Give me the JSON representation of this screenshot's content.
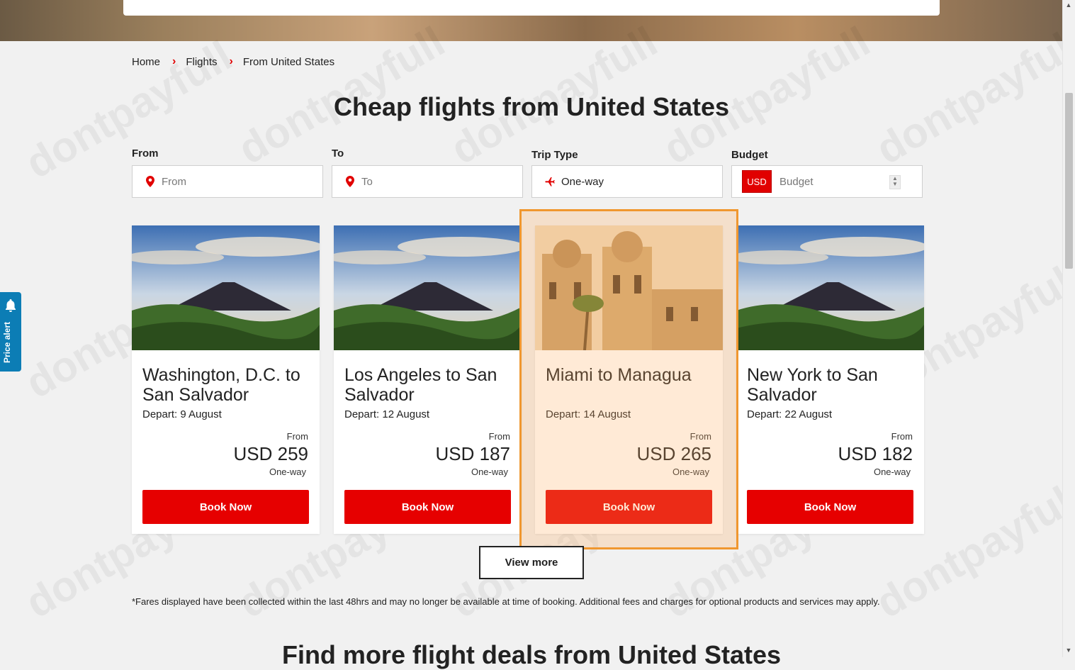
{
  "breadcrumb": {
    "items": [
      "Home",
      "Flights",
      "From United States"
    ]
  },
  "page_title": "Cheap flights from United States",
  "search": {
    "from_label": "From",
    "from_placeholder": "From",
    "to_label": "To",
    "to_placeholder": "To",
    "trip_type_label": "Trip Type",
    "trip_type_value": "One-way",
    "budget_label": "Budget",
    "budget_currency": "USD",
    "budget_placeholder": "Budget"
  },
  "cards": [
    {
      "route": "Washington, D.C. to San Salvador",
      "depart": "Depart: 9 August",
      "from_label": "From",
      "price": "USD 259",
      "trip": "One-way",
      "button": "Book Now",
      "image": "volcano"
    },
    {
      "route": "Los Angeles to San Salvador",
      "depart": "Depart: 12 August",
      "from_label": "From",
      "price": "USD 187",
      "trip": "One-way",
      "button": "Book Now",
      "image": "volcano"
    },
    {
      "route": "Miami to Managua",
      "depart": "Depart: 14 August",
      "from_label": "From",
      "price": "USD 265",
      "trip": "One-way",
      "button": "Book Now",
      "image": "cathedral"
    },
    {
      "route": "New York to San Salvador",
      "depart": "Depart: 22 August",
      "from_label": "From",
      "price": "USD 182",
      "trip": "One-way",
      "button": "Book Now",
      "image": "volcano"
    }
  ],
  "view_more": "View more",
  "disclaimer": "*Fares displayed have been collected within the last 48hrs and may no longer be available at time of booking. Additional fees and charges for optional products and services may apply.",
  "more_deals_title": "Find more flight deals from United States",
  "price_alert": "Price alert",
  "watermark": "dontpayfull",
  "colors": {
    "accent": "#e60000",
    "highlight": "#f0972f",
    "price_alert": "#0c7db5"
  }
}
